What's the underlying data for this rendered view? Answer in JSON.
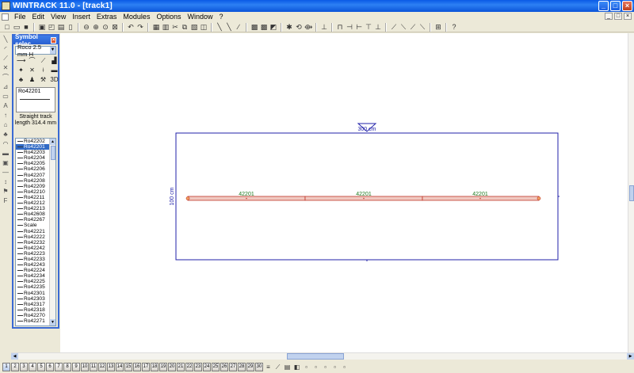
{
  "window": {
    "title": "WINTRACK 11.0 - [track1]",
    "min": "_",
    "max": "□",
    "close": "×"
  },
  "menu": [
    "File",
    "Edit",
    "View",
    "Insert",
    "Extras",
    "Modules",
    "Options",
    "Window",
    "?"
  ],
  "palette": {
    "title": "Symbol selec...",
    "close": "×",
    "system": "Roco 2.5 mm H",
    "preview_id": "Ro42201",
    "description_line1": "Straight track",
    "description_line2": "length 314.4 mm",
    "items": [
      "Ro42202",
      "Ro42201",
      "Ro42203",
      "Ro42204",
      "Ro42205",
      "Ro42206",
      "Ro42207",
      "Ro42208",
      "Ro42209",
      "Ro42210",
      "Ro42211",
      "Ro42212",
      "Ro42213",
      "Ro42608",
      "Ro42267",
      "Scale",
      "Ro42221",
      "Ro42222",
      "Ro42232",
      "Ro42242",
      "Ro42223",
      "Ro42233",
      "Ro42243",
      "Ro42224",
      "Ro42234",
      "Ro42225",
      "Ro42235",
      "Ro42301",
      "Ro42303",
      "Ro42317",
      "Ro42318",
      "Ro42270",
      "Ro42271"
    ],
    "selected_index": 1
  },
  "canvas": {
    "width_label": "300 cm",
    "height_label": "100 cm",
    "segment_labels": [
      "42201",
      "42201",
      "42201"
    ]
  },
  "layers": [
    "1",
    "2",
    "3",
    "4",
    "5",
    "6",
    "7",
    "8",
    "9",
    "10",
    "11",
    "12",
    "13",
    "14",
    "15",
    "16",
    "17",
    "18",
    "19",
    "20",
    "21",
    "22",
    "23",
    "24",
    "25",
    "26",
    "27",
    "28",
    "29",
    "30"
  ],
  "colors": {
    "track_fill": "#f0c8c0",
    "track_stroke": "#c0392b",
    "label": "#1f7a1f",
    "board": "#2222aa"
  }
}
